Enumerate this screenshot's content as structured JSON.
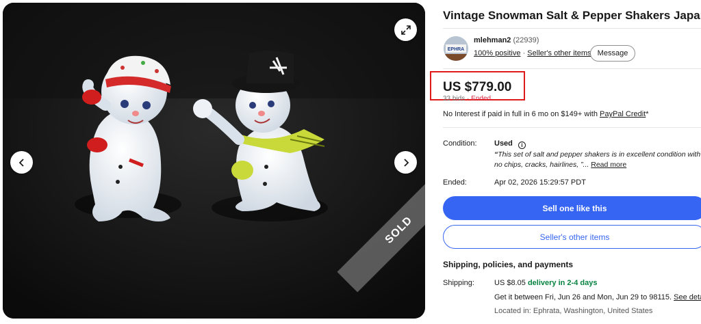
{
  "gallery": {
    "sold_label": "SOLD"
  },
  "listing": {
    "title": "Vintage Snowman Salt & Pepper Shakers Japan"
  },
  "seller": {
    "name": "mlehman2",
    "feedback_count": "(22939)",
    "positive": "100% positive",
    "sep1": "·",
    "other_items": "Seller's other items",
    "sep2": "·",
    "message_label": "Message",
    "avatar_text": "EPHRA"
  },
  "price": {
    "amount": "US $779.00",
    "bids": "33 bids",
    "bids_sep": "·",
    "status": "Ended"
  },
  "financing": {
    "text": "No Interest if paid in full in 6 mo on $149+ with ",
    "link": "PayPal Credit",
    "suffix": "*"
  },
  "condition": {
    "label": "Condition:",
    "value": "Used",
    "info_glyph": "i",
    "quote_mark": "“",
    "quote": "This set of salt and pepper shakers is in excellent condition with no chips, cracks, hairlines, ",
    "quote_end": "”... ",
    "read_more": "Read more"
  },
  "ended": {
    "label": "Ended:",
    "value": "Apr 02, 2026 15:29:57 PDT"
  },
  "actions": {
    "sell_one": "Sell one like this",
    "sellers_other_items": "Seller's other items"
  },
  "shipping": {
    "section_title": "Shipping, policies, and payments",
    "label": "Shipping:",
    "cost": "US $8.05",
    "delivery": "delivery in 2-4 days",
    "window": "Get it between Fri, Jun 26 and Mon, Jun 29 to 98115. ",
    "see_details": "See details",
    "location": "Located in: Ephrata, Washington, United States"
  },
  "colors": {
    "accent_blue": "#3665f3",
    "ended_red": "#d7263d",
    "highlight_red": "#e0191b",
    "delivery_green": "#05823f"
  }
}
